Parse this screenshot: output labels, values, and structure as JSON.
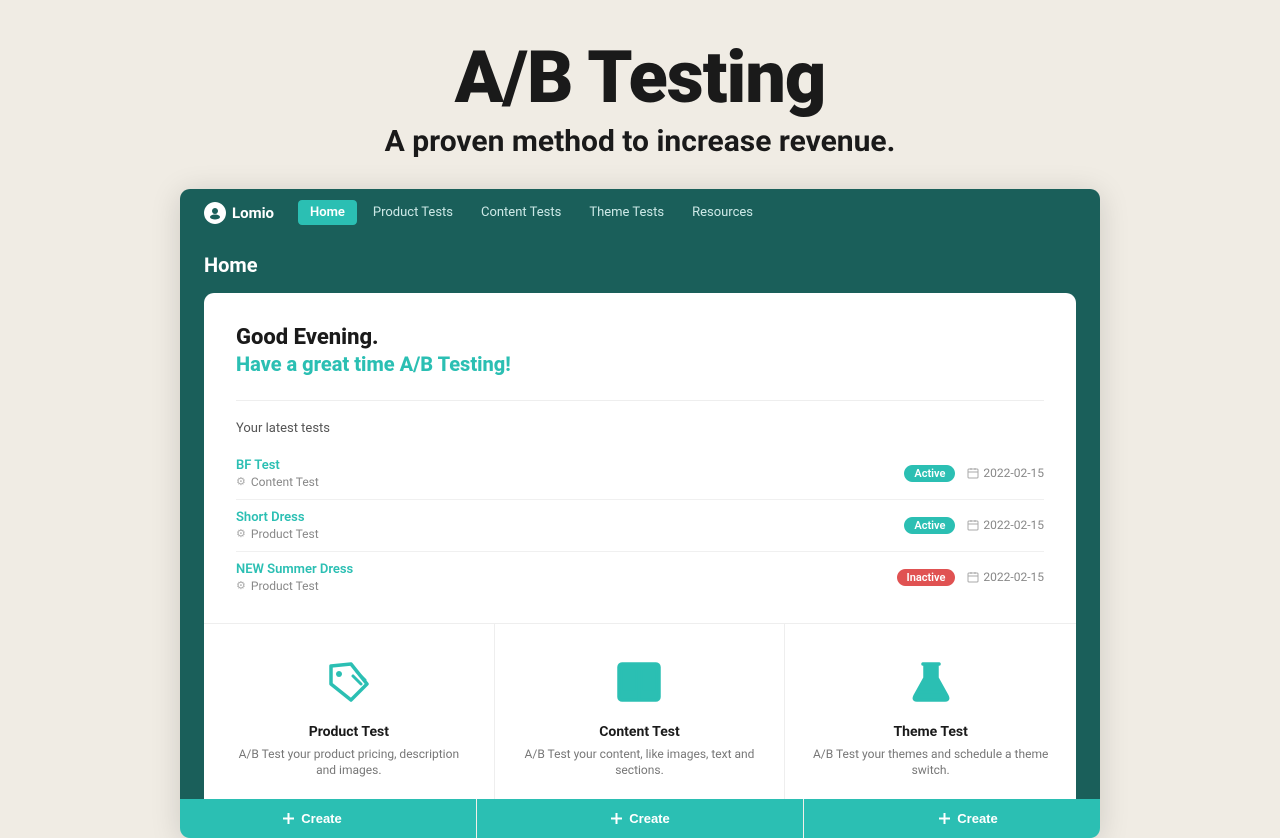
{
  "hero": {
    "title": "A/B Testing",
    "subtitle": "A proven method to increase revenue."
  },
  "nav": {
    "logo": "Lomio",
    "links": [
      {
        "label": "Home",
        "active": true
      },
      {
        "label": "Product Tests",
        "active": false
      },
      {
        "label": "Content Tests",
        "active": false
      },
      {
        "label": "Theme Tests",
        "active": false
      },
      {
        "label": "Resources",
        "active": false
      }
    ]
  },
  "page": {
    "title": "Home"
  },
  "greeting": {
    "line1": "Good Evening.",
    "line2": "Have a great time A/B Testing!"
  },
  "latest_tests": {
    "label": "Your latest tests",
    "tests": [
      {
        "name": "BF Test",
        "type": "Content Test",
        "status": "Active",
        "date": "2022-02-15"
      },
      {
        "name": "Short Dress",
        "type": "Product Test",
        "status": "Active",
        "date": "2022-02-15"
      },
      {
        "name": "NEW Summer Dress",
        "type": "Product Test",
        "status": "Inactive",
        "date": "2022-02-15"
      }
    ]
  },
  "features": [
    {
      "id": "product-test",
      "title": "Product Test",
      "description": "A/B Test your product pricing, description and images.",
      "create_label": "Create"
    },
    {
      "id": "content-test",
      "title": "Content Test",
      "description": "A/B Test your content, like images, text and sections.",
      "create_label": "Create"
    },
    {
      "id": "theme-test",
      "title": "Theme Test",
      "description": "A/B Test your themes and schedule a theme switch.",
      "create_label": "Create"
    }
  ],
  "colors": {
    "teal": "#2bbfb3",
    "dark_teal": "#1a5f5a",
    "active_badge": "#2bbfb3",
    "inactive_badge": "#e05252"
  }
}
